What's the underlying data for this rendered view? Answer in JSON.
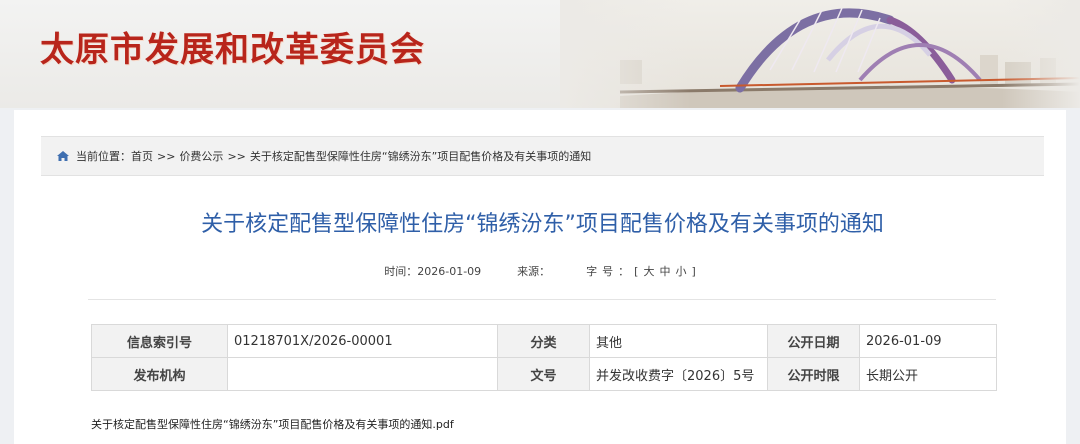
{
  "site": {
    "title": "太原市发展和改革委员会"
  },
  "breadcrumb": {
    "prefix": "当前位置：",
    "items": [
      "首页",
      "价费公示",
      "关于核定配售型保障性住房“锦绣汾东”项目配售价格及有关事项的通知"
    ],
    "separator": ">>"
  },
  "article": {
    "title": "关于核定配售型保障性住房“锦绣汾东”项目配售价格及有关事项的通知",
    "time_label": "时间：",
    "time_value": "2026-01-09",
    "source_label": "来源：",
    "source_value": "",
    "fontsize_label": "字号：",
    "fontsize_open": "[",
    "fontsize_large": "大",
    "fontsize_medium": "中",
    "fontsize_small": "小",
    "fontsize_close": "]"
  },
  "info_table": {
    "rows": [
      [
        {
          "label": "信息索引号",
          "value": "01218701X/2026-00001"
        },
        {
          "label": "分类",
          "value": "其他"
        },
        {
          "label": "公开日期",
          "value": "2026-01-09"
        }
      ],
      [
        {
          "label": "发布机构",
          "value": ""
        },
        {
          "label": "文号",
          "value": "并发改收费字〔2026〕5号"
        },
        {
          "label": "公开时限",
          "value": "长期公开"
        }
      ]
    ]
  },
  "attachment": {
    "name": "关于核定配售型保障性住房“锦绣汾东”项目配售价格及有关事项的通知.pdf"
  },
  "icons": {
    "breadcrumb": "home-icon",
    "banner": "bridge-illustration"
  },
  "colors": {
    "title": "#b8251b",
    "article_title": "#2f5fa8",
    "home_icon": "#3f6fb0"
  }
}
